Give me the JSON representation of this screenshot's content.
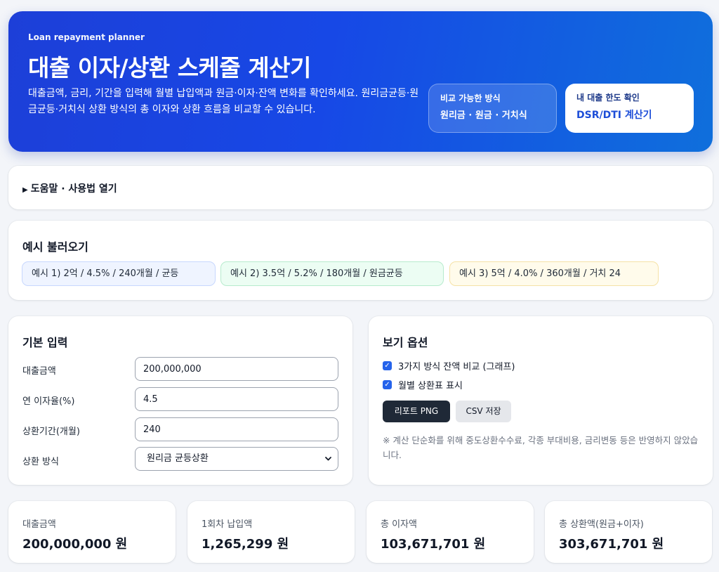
{
  "hero": {
    "eyebrow": "Loan repayment planner",
    "title": "대출 이자/상환 스케줄 계산기",
    "description": "대출금액, 금리, 기간을 입력해 월별 납입액과 원금·이자·잔액 변화를 확인하세요. 원리금균등·원금균등·거치식 상환 방식의 총 이자와 상환 흐름을 비교할 수 있습니다.",
    "methods_label": "비교 가능한 방식",
    "methods_value": "원리금 · 원금 · 거치식",
    "limit_label": "내 대출 한도 확인",
    "limit_value": "DSR/DTI 계산기"
  },
  "help": {
    "toggle_label": "도움말 · 사용법 열기"
  },
  "examples": {
    "title": "예시 불러오기",
    "chips": [
      "예시 1) 2억 / 4.5% / 240개월 / 균등",
      "예시 2) 3.5억 / 5.2% / 180개월 / 원금균등",
      "예시 3) 5억 / 4.0% / 360개월 / 거치 24"
    ]
  },
  "basic": {
    "title": "기본 입력",
    "amount_label": "대출금액",
    "amount_value": "200,000,000",
    "rate_label": "연 이자율(%)",
    "rate_value": "4.5",
    "term_label": "상환기간(개월)",
    "term_value": "240",
    "method_label": "상환 방식",
    "method_value": "원리금 균등상환"
  },
  "options": {
    "title": "보기 옵션",
    "check1_label": "3가지 방식 잔액 비교 (그래프)",
    "check1_checked": true,
    "check2_label": "월별 상환표 표시",
    "check2_checked": true,
    "report_button": "리포트 PNG",
    "csv_button": "CSV 저장",
    "note": "※ 계산 단순화를 위해 중도상환수수료, 각종 부대비용, 금리변동 등은 반영하지 않았습니다."
  },
  "stats": [
    {
      "label": "대출금액",
      "value": "200,000,000 원"
    },
    {
      "label": "1회차 납입액",
      "value": "1,265,299 원"
    },
    {
      "label": "총 이자액",
      "value": "103,671,701 원"
    },
    {
      "label": "총 상환액(원금+이자)",
      "value": "303,671,701 원"
    }
  ],
  "colors": {
    "primary": "#1d4ed8",
    "dark_button": "#1f2937",
    "checkbox": "#2563eb"
  }
}
